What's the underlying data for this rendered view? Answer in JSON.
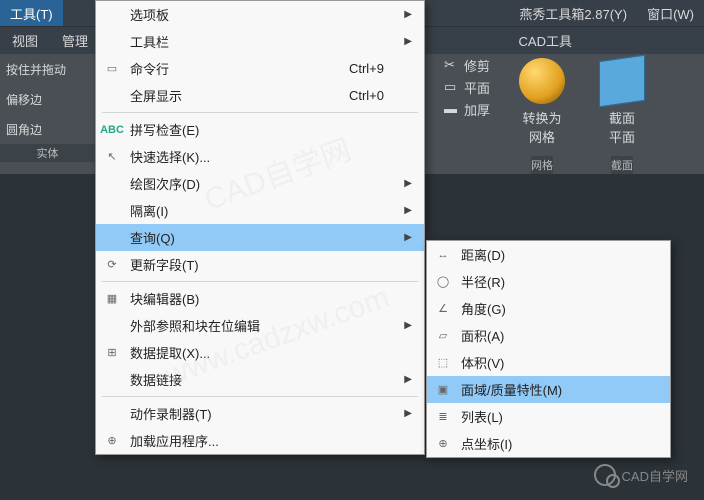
{
  "topmenu": {
    "tool": "工具(T)",
    "yanxiu": "燕秀工具箱2.87(Y)",
    "win": "窗口(W)"
  },
  "secbar": {
    "view": "视图",
    "manage": "管理",
    "cadtool": "CAD工具"
  },
  "leftcol": {
    "hold": "按住并拖动",
    "offset": "偏移边",
    "round": "圆角边",
    "solid": "实体"
  },
  "menu": {
    "options": "选项板",
    "toolbar": "工具栏",
    "cmdline": "命令行",
    "cmdline_sc": "Ctrl+9",
    "fullscreen": "全屏显示",
    "fullscreen_sc": "Ctrl+0",
    "spell": "拼写检查(E)",
    "qselect": "快速选择(K)...",
    "draworder": "绘图次序(D)",
    "isolate": "隔离(I)",
    "inquiry": "查询(Q)",
    "updatefield": "更新字段(T)",
    "blockedit": "块编辑器(B)",
    "xref": "外部参照和块在位编辑",
    "dataextract": "数据提取(X)...",
    "datalink": "数据链接",
    "actionrec": "动作录制器(T)",
    "loadapp": "加载应用程序..."
  },
  "submenu": {
    "distance": "距离(D)",
    "radius": "半径(R)",
    "angle": "角度(G)",
    "area": "面积(A)",
    "volume": "体积(V)",
    "massprop": "面域/质量特性(M)",
    "list": "列表(L)",
    "idpoint": "点坐标(I)"
  },
  "rtools": {
    "trim": "修剪",
    "plane": "平面",
    "thicken": "加厚",
    "convertmesh": "转换为",
    "convertmesh2": "网格",
    "mesh": "网格",
    "section": "截面",
    "secplane": "平面",
    "sectiongrp": "截面"
  },
  "watermark": {
    "a": "CAD自学网",
    "b": "www.cadzxw.com"
  },
  "footer": {
    "wechat": "CAD自学网"
  }
}
